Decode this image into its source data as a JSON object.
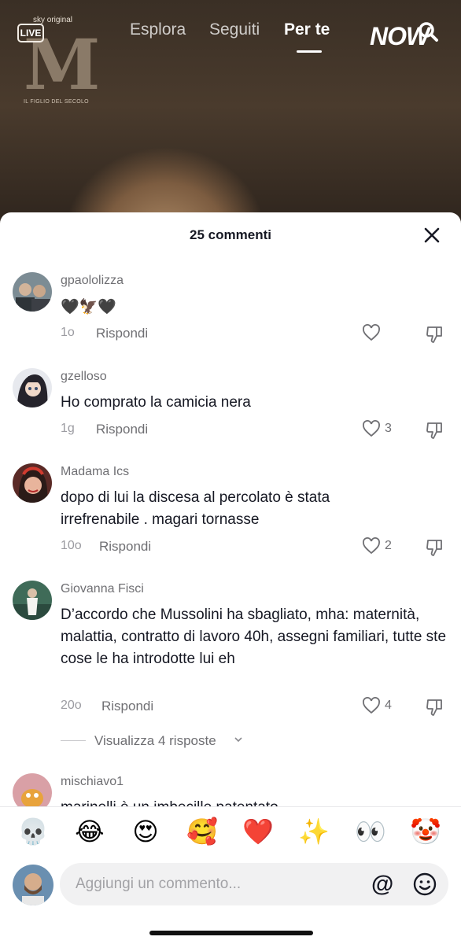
{
  "header": {
    "brand_small": "sky original",
    "live_label": "LIVE",
    "brand_letter": "M",
    "brand_sub": "IL FIGLIO DEL SECOLO",
    "tabs": [
      {
        "label": "Esplora",
        "active": false
      },
      {
        "label": "Seguiti",
        "active": false
      },
      {
        "label": "Per te",
        "active": true
      }
    ],
    "now_logo": "NOW"
  },
  "sheet": {
    "title": "25 commenti"
  },
  "comments": [
    {
      "username": "gpaololizza",
      "text": "🖤🦅🖤",
      "time": "1o",
      "reply": "Rispondi",
      "likes": ""
    },
    {
      "username": "gzelloso",
      "text": "Ho comprato la camicia nera",
      "time": "1g",
      "reply": "Rispondi",
      "likes": "3"
    },
    {
      "username": "Madama Ics",
      "text": "dopo di lui la discesa al percolato è stata irrefrenabile . magari tornasse",
      "time": "10o",
      "reply": "Rispondi",
      "likes": "2"
    },
    {
      "username": "Giovanna Fisci",
      "text": "D’accordo che Mussolini ha sbagliato, mha: maternità, malattia, contratto di lavoro 40h, assegni familiari, tutte ste cose le ha introdotte lui eh",
      "time": "20o",
      "reply": "Rispondi",
      "likes": "4",
      "view_replies": "Visualizza 4 risposte"
    },
    {
      "username": "mischiavo1",
      "text": "marinelli è un imbecille patentato",
      "time": "",
      "reply": "",
      "likes": ""
    }
  ],
  "emoji_bar": [
    "💀",
    "😂",
    "😍",
    "🥰",
    "❤️",
    "✨",
    "👀",
    "🤡"
  ],
  "input": {
    "placeholder": "Aggiungi un commento...",
    "at_label": "@"
  },
  "colors": {
    "text_primary": "#161823",
    "text_secondary": "#6f6f73",
    "sheet_bg": "#ffffff",
    "input_bg": "#f1f1f2"
  }
}
